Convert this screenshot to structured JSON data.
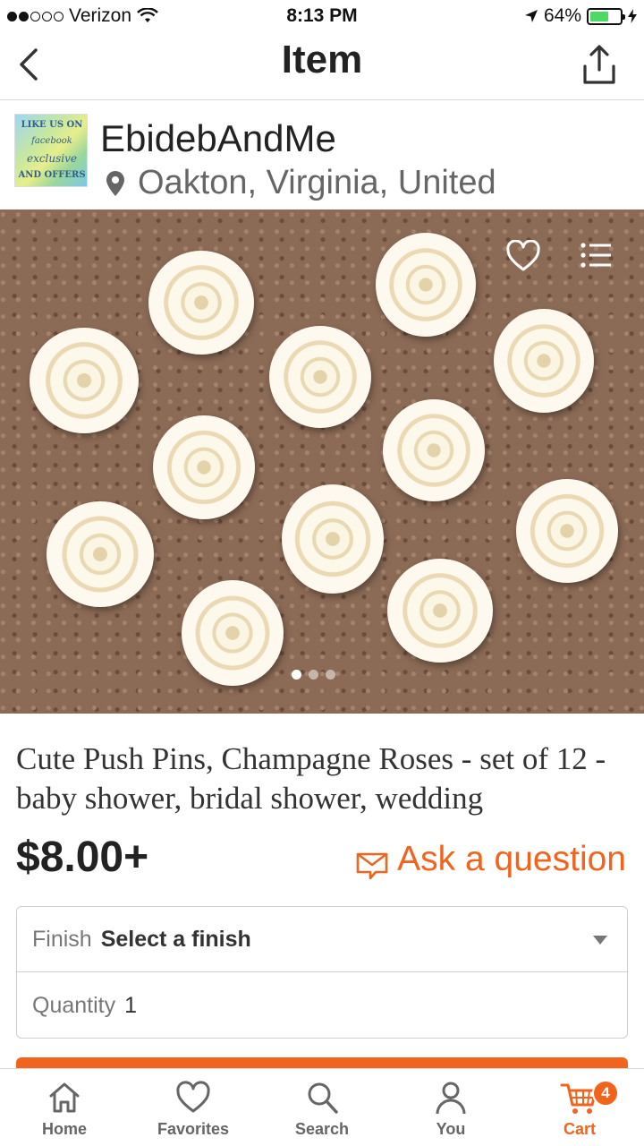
{
  "status_bar": {
    "carrier": "Verizon",
    "time": "8:13 PM",
    "battery": "64%",
    "battery_level": 0.64,
    "signal_bars": 2
  },
  "nav": {
    "title": "Item",
    "back_icon": "chevron-left-icon",
    "share_icon": "share-icon"
  },
  "shop": {
    "name": "EbidebAndMe",
    "location": "Oakton, Virginia, United",
    "avatar_text": [
      "LIKE US ON",
      "facebook",
      "exclusive",
      "AND OFFERS"
    ]
  },
  "photo": {
    "page_count": 3,
    "current_page": 1,
    "favorite_icon": "heart-outline-icon",
    "list_icon": "list-icon"
  },
  "item": {
    "title": "Cute Push Pins, Champagne Roses - set of 12 - baby shower, bridal shower, wedding",
    "price": "$8.00+",
    "ask_label": "Ask a question"
  },
  "variations": {
    "finish_label": "Finish",
    "finish_value": "Select a finish",
    "quantity_label": "Quantity",
    "quantity_value": "1"
  },
  "tabs": [
    {
      "label": "Home",
      "icon": "home-icon"
    },
    {
      "label": "Favorites",
      "icon": "heart-icon"
    },
    {
      "label": "Search",
      "icon": "search-icon"
    },
    {
      "label": "You",
      "icon": "person-icon"
    },
    {
      "label": "Cart",
      "icon": "cart-icon",
      "badge": "4"
    }
  ],
  "colors": {
    "accent": "#f1641e",
    "text": "#222222",
    "muted": "#666666"
  }
}
